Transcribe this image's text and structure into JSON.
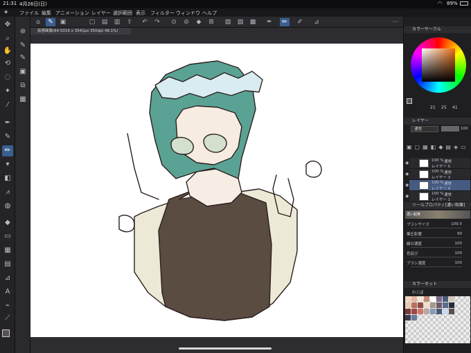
{
  "status": {
    "time": "21:31",
    "date": "4月26日(日)",
    "battery": "89%"
  },
  "menu": [
    "ファイル",
    "編集",
    "アニメーション",
    "レイヤー",
    "選択範囲",
    "表示",
    "フィルター",
    "ウィンドウ",
    "ヘルプ"
  ],
  "doc_tab": "仮想画像(84.5016 x 3541px 350dpi 48.1%)",
  "color_panel": {
    "title": "カラーサークル",
    "h": "21",
    "s": "25",
    "v": "41"
  },
  "layer_panel": {
    "title": "レイヤー",
    "blend": "通常",
    "opacity": "100"
  },
  "layers": [
    {
      "pct": "100 %",
      "mode": "通常",
      "name": "レイヤー 5"
    },
    {
      "pct": "100 %",
      "mode": "通常",
      "name": "レイヤー 3"
    },
    {
      "pct": "100 %",
      "mode": "通常",
      "name": "レイヤー 4",
      "selected": true
    },
    {
      "pct": "100 %",
      "mode": "通常",
      "name": "レイヤー 1"
    }
  ],
  "tool_property": {
    "title": "ツールプロパティ[濃い鉛筆]",
    "brush": "濃い鉛筆"
  },
  "props": [
    {
      "label": "ブラシサイズ",
      "value": "109.5"
    },
    {
      "label": "筆圧影響",
      "value": "90"
    },
    {
      "label": "線の濃度",
      "value": "100"
    },
    {
      "label": "色延び",
      "value": "100"
    },
    {
      "label": "ブラシ濃度",
      "value": "100"
    }
  ],
  "colorset": {
    "title": "カラーセット",
    "name": "わこば"
  },
  "accent": "#3a5f8f"
}
